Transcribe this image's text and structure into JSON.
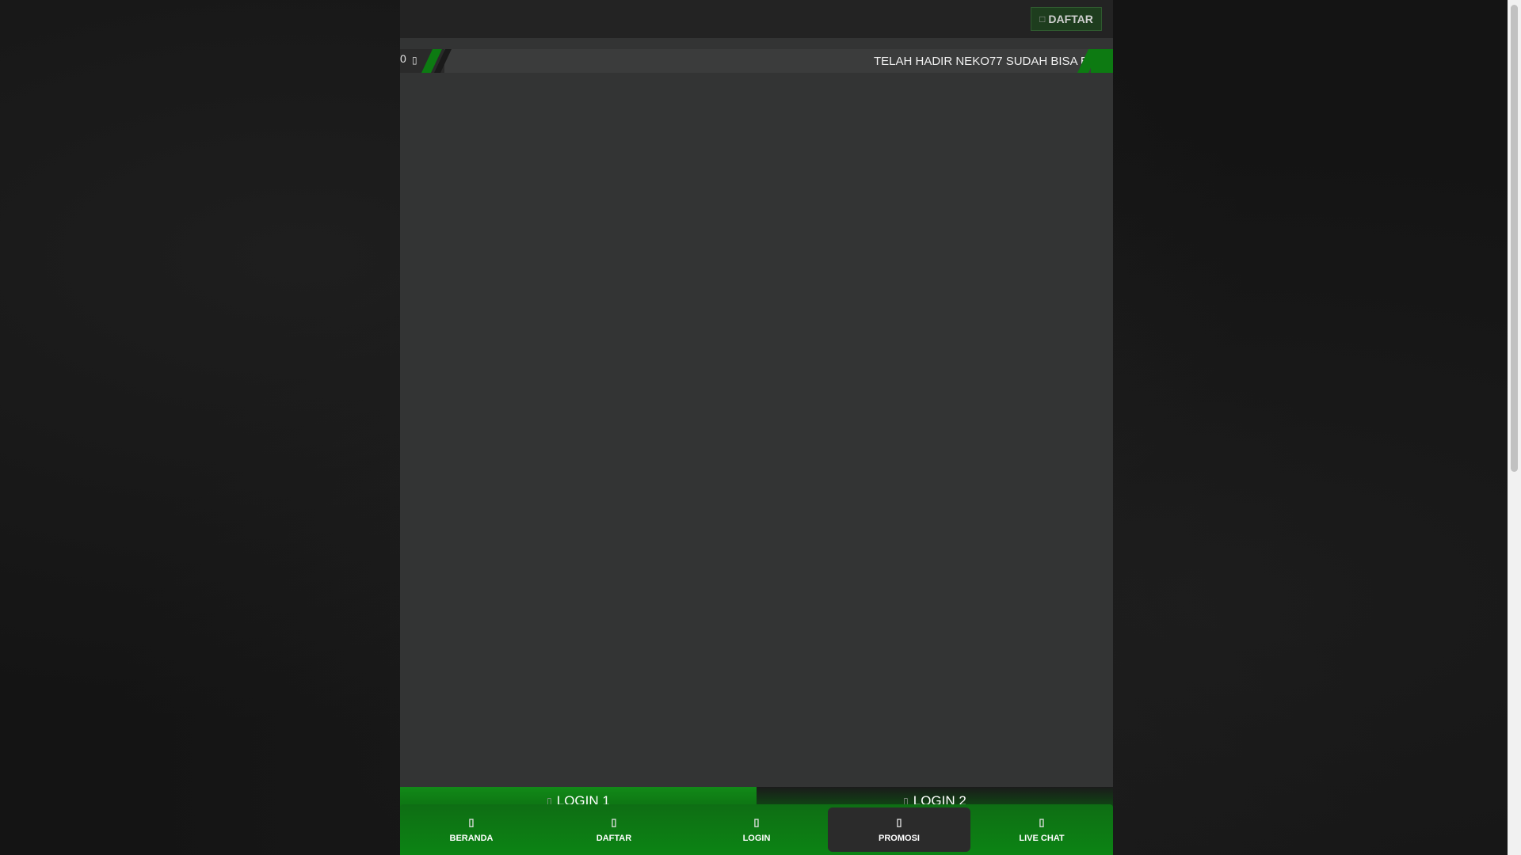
{
  "header": {
    "daftar_label": "DAFTAR",
    "daftar_icon": "user-plus-icon"
  },
  "ticker": {
    "counter": "0",
    "speaker_icon": "speaker-icon",
    "text": "TELAH HADIR NEKO77 SUDAH BISA B"
  },
  "login_buttons": [
    {
      "label": "LOGIN 1",
      "icon": "login-icon"
    },
    {
      "label": "LOGIN 2",
      "icon": "login-icon"
    }
  ],
  "bottom_nav": [
    {
      "label": "BERANDA",
      "icon": "home-icon"
    },
    {
      "label": "DAFTAR",
      "icon": "user-plus-icon"
    },
    {
      "label": "LOGIN",
      "icon": "login-icon"
    },
    {
      "label": "PROMOSI",
      "icon": "gift-icon",
      "active": true
    },
    {
      "label": "LIVE CHAT",
      "icon": "chat-icon"
    }
  ],
  "colors": {
    "accent_green": "#0d7a12",
    "frame_bg": "#333434",
    "page_bg": "#141414"
  }
}
